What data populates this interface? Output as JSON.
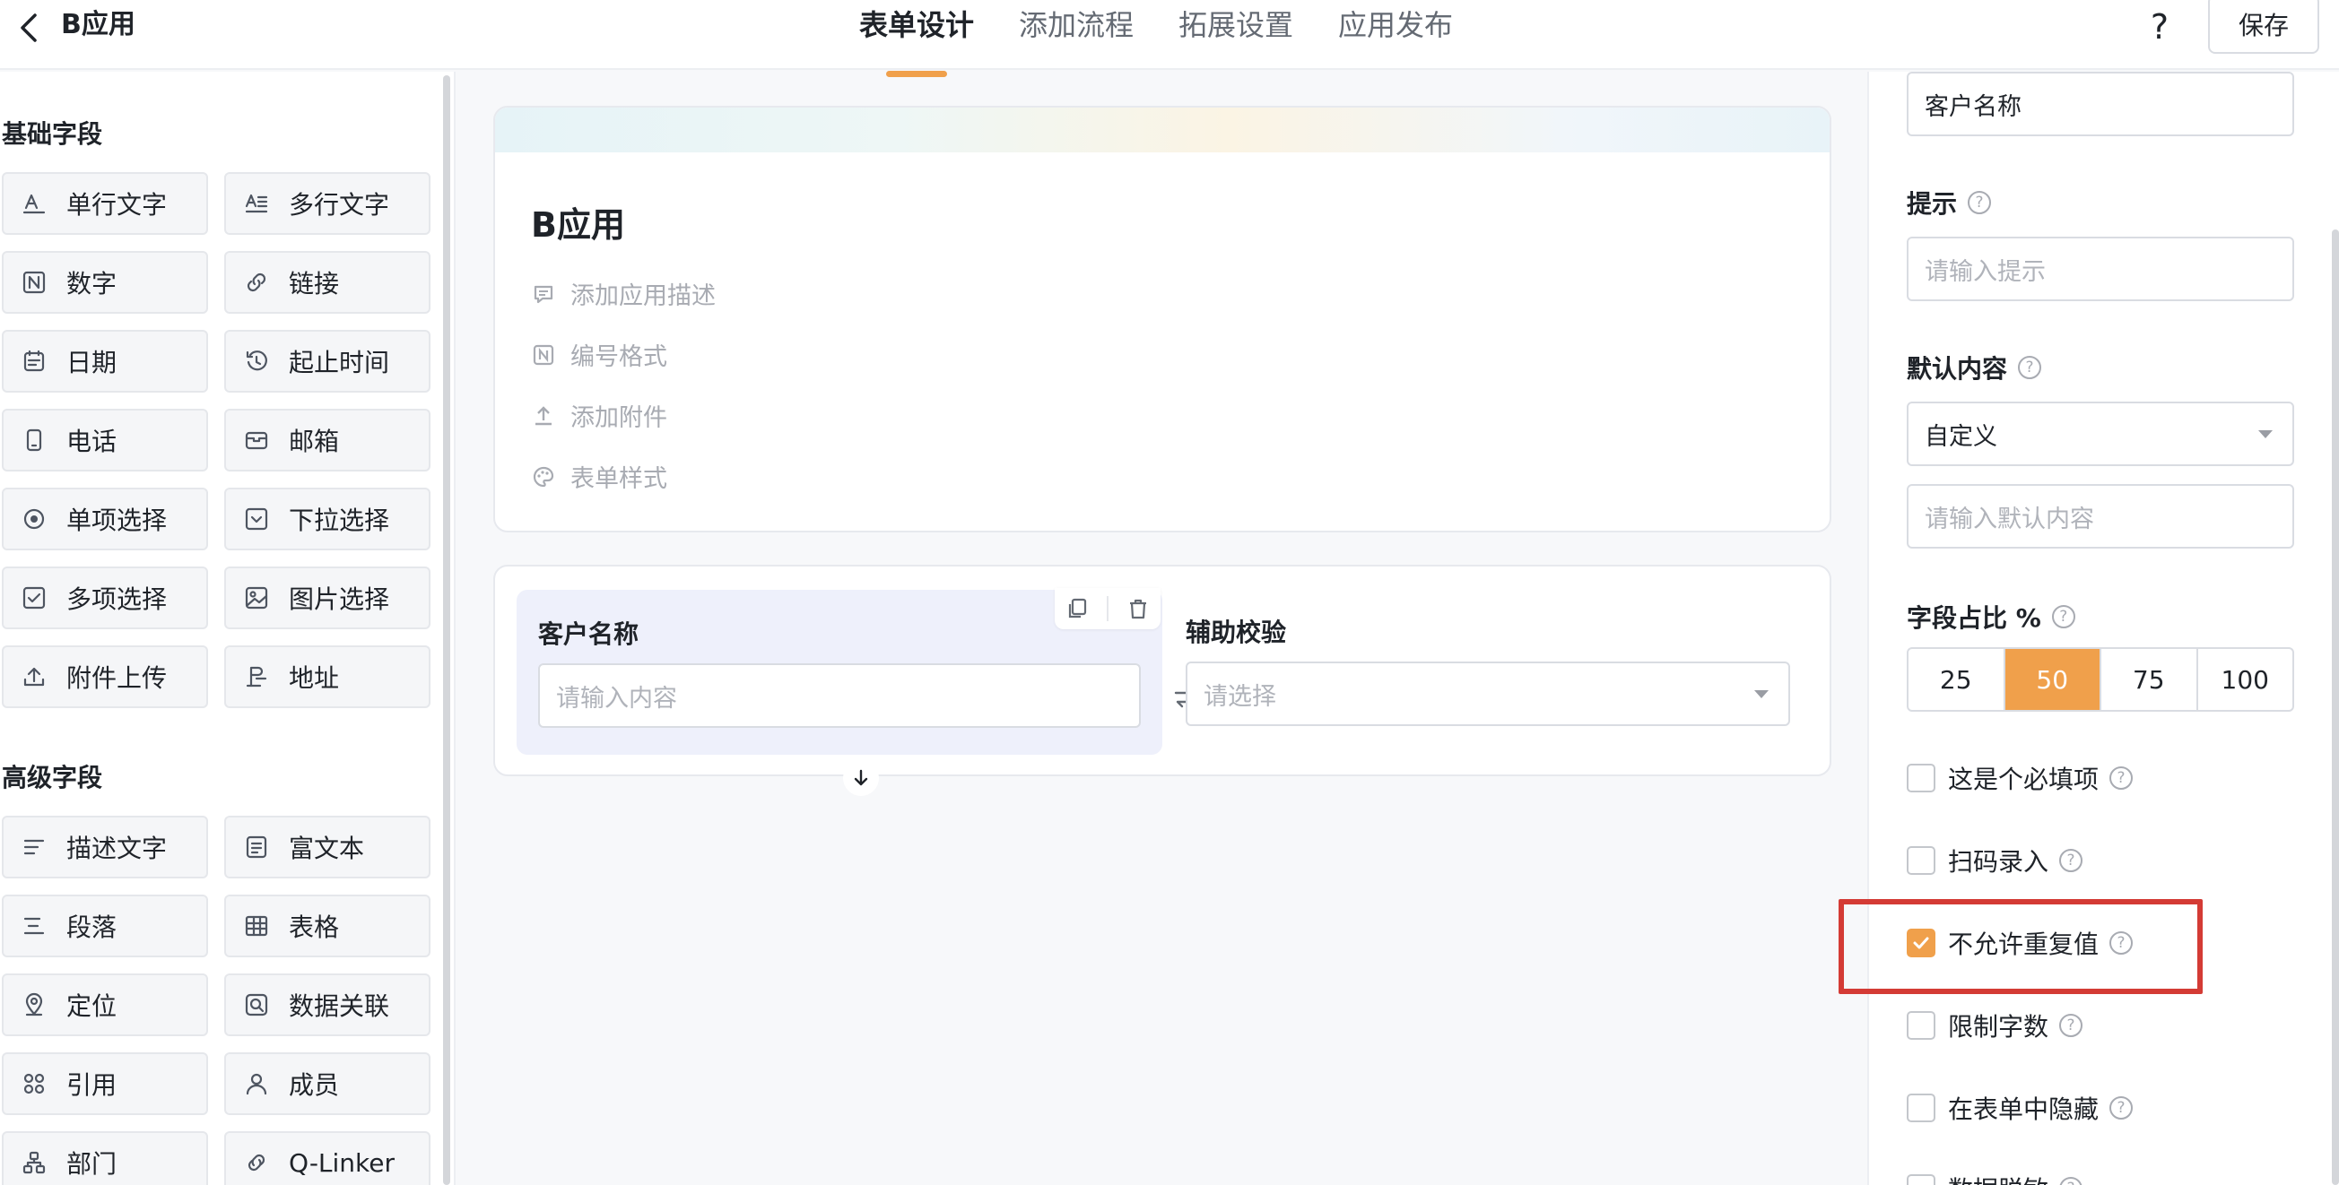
{
  "header": {
    "back_icon": "chevron-left-icon",
    "app_title": "B应用",
    "tabs": [
      {
        "label": "表单设计",
        "active": true
      },
      {
        "label": "添加流程",
        "active": false
      },
      {
        "label": "拓展设置",
        "active": false
      },
      {
        "label": "应用发布",
        "active": false
      }
    ],
    "help_label": "?",
    "save_label": "保存"
  },
  "palette": {
    "basic_title": "基础字段",
    "basic_fields": [
      {
        "label": "单行文字",
        "icon": "single-line-text-icon"
      },
      {
        "label": "多行文字",
        "icon": "multi-line-text-icon"
      },
      {
        "label": "数字",
        "icon": "number-icon"
      },
      {
        "label": "链接",
        "icon": "link-icon"
      },
      {
        "label": "日期",
        "icon": "calendar-icon"
      },
      {
        "label": "起止时间",
        "icon": "time-range-icon"
      },
      {
        "label": "电话",
        "icon": "phone-icon"
      },
      {
        "label": "邮箱",
        "icon": "mail-icon"
      },
      {
        "label": "单项选择",
        "icon": "radio-icon"
      },
      {
        "label": "下拉选择",
        "icon": "dropdown-icon"
      },
      {
        "label": "多项选择",
        "icon": "checkbox-icon"
      },
      {
        "label": "图片选择",
        "icon": "image-icon"
      },
      {
        "label": "附件上传",
        "icon": "upload-icon"
      },
      {
        "label": "地址",
        "icon": "address-icon"
      }
    ],
    "advanced_title": "高级字段",
    "advanced_fields": [
      {
        "label": "描述文字",
        "icon": "description-icon"
      },
      {
        "label": "富文本",
        "icon": "rich-text-icon"
      },
      {
        "label": "段落",
        "icon": "paragraph-icon"
      },
      {
        "label": "表格",
        "icon": "table-icon"
      },
      {
        "label": "定位",
        "icon": "location-icon"
      },
      {
        "label": "数据关联",
        "icon": "data-link-icon"
      },
      {
        "label": "引用",
        "icon": "reference-icon"
      },
      {
        "label": "成员",
        "icon": "member-icon"
      },
      {
        "label": "部门",
        "icon": "department-icon"
      },
      {
        "label": "Q-Linker",
        "icon": "q-linker-icon"
      }
    ]
  },
  "form": {
    "title": "B应用",
    "meta": [
      {
        "label": "添加应用描述",
        "icon": "comment-icon"
      },
      {
        "label": "编号格式",
        "icon": "number-format-icon"
      },
      {
        "label": "添加附件",
        "icon": "upload-icon"
      },
      {
        "label": "表单样式",
        "icon": "palette-icon"
      }
    ],
    "fields": [
      {
        "label": "客户名称",
        "placeholder": "请输入内容"
      },
      {
        "label": "辅助校验",
        "placeholder": "请选择"
      }
    ]
  },
  "props": {
    "field_name_value": "客户名称",
    "hint_label": "提示",
    "hint_placeholder": "请输入提示",
    "default_label": "默认内容",
    "default_mode": "自定义",
    "default_placeholder": "请输入默认内容",
    "ratio_label": "字段占比 %",
    "ratio_options": [
      "25",
      "50",
      "75",
      "100"
    ],
    "ratio_selected": "50",
    "options": [
      {
        "label": "这是个必填项",
        "checked": false
      },
      {
        "label": "扫码录入",
        "checked": false
      },
      {
        "label": "不允许重复值",
        "checked": true
      },
      {
        "label": "限制字数",
        "checked": false
      },
      {
        "label": "在表单中隐藏",
        "checked": false
      },
      {
        "label": "数据脱敏",
        "checked": false
      }
    ]
  },
  "colors": {
    "accent": "#f0a04b",
    "highlight_border": "#d43b35",
    "active_field_bg": "#eef0fb"
  }
}
